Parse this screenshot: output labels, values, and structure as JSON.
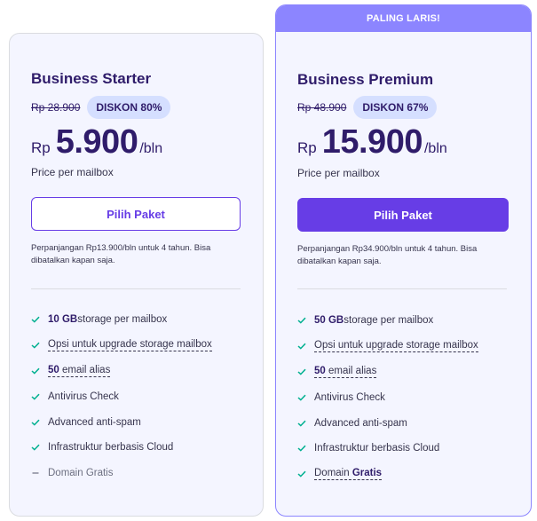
{
  "plans": [
    {
      "name": "Business Starter",
      "old_price": "Rp 28.900",
      "discount": "DISKON 80%",
      "currency": "Rp",
      "price": "5.900",
      "period": "/bln",
      "per_mailbox": "Price per mailbox",
      "button_label": "Pilih Paket",
      "renewal": "Perpanjangan Rp13.900/bln untuk 4 tahun. Bisa dibatalkan kapan saja.",
      "features": {
        "storage_bold": "10 GB",
        "storage_rest": " storage per mailbox",
        "upgrade": "Opsi untuk upgrade storage mailbox",
        "alias_bold": "50",
        "alias_rest": " email alias",
        "antivirus": "Antivirus Check",
        "antispam": "Advanced anti-spam",
        "cloud": "Infrastruktur berbasis Cloud",
        "domain": "Domain Gratis"
      }
    },
    {
      "ribbon": "PALING LARIS!",
      "name": "Business Premium",
      "old_price": "Rp 48.900",
      "discount": "DISKON 67%",
      "currency": "Rp",
      "price": "15.900",
      "period": "/bln",
      "per_mailbox": "Price per mailbox",
      "button_label": "Pilih Paket",
      "renewal": "Perpanjangan Rp34.900/bln untuk 4 tahun. Bisa dibatalkan kapan saja.",
      "features": {
        "storage_bold": "50 GB",
        "storage_rest": " storage per mailbox",
        "upgrade": "Opsi untuk upgrade storage mailbox",
        "alias_bold": "50",
        "alias_rest": " email alias",
        "antivirus": "Antivirus Check",
        "antispam": "Advanced anti-spam",
        "cloud": "Infrastruktur berbasis Cloud",
        "domain_prefix": "Domain ",
        "domain_bold": "Gratis"
      }
    }
  ],
  "colors": {
    "accent": "#673de6",
    "highlight": "#8c85ff",
    "check": "#00b090",
    "card_bg": "#f4f5ff",
    "badge_bg": "#d5dfff"
  },
  "icons": {
    "included": "check-icon",
    "excluded": "dash-icon"
  }
}
